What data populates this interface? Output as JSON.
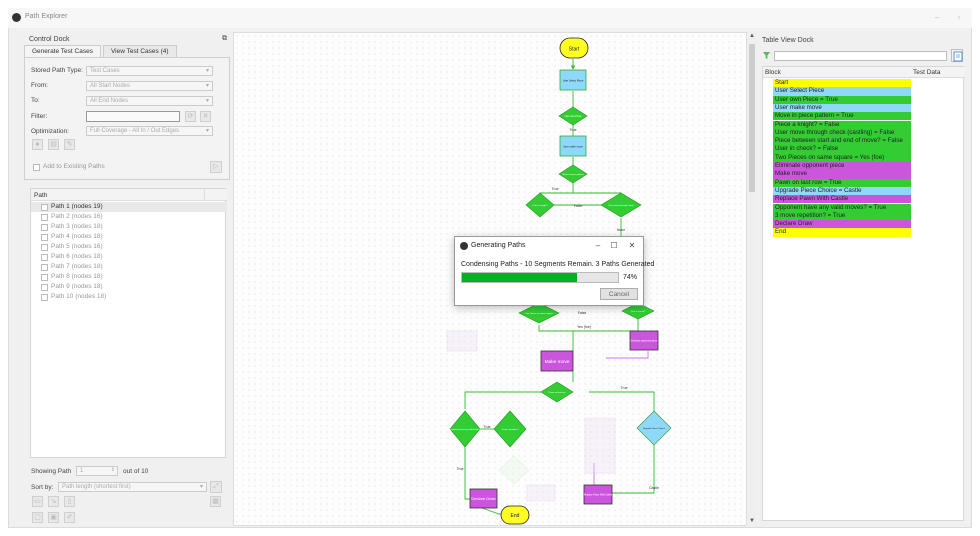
{
  "window": {
    "title": "Path Explorer"
  },
  "control_dock": {
    "title": "Control Dock",
    "tabs": [
      "Generate Test Cases",
      "View Test Cases (4)"
    ],
    "stored_path_type_label": "Stored Path Type:",
    "stored_path_type_value": "Test Cases",
    "from_label": "From:",
    "from_value": "All Start Nodes",
    "to_label": "To:",
    "to_value": "All End Nodes",
    "filter_label": "Filter:",
    "optimization_label": "Optimization:",
    "optimization_value": "Full Coverage - All In / Out Edges",
    "add_existing_label": "Add to Existing Paths",
    "path_column": "Path",
    "paths": [
      "Path 1 (nodes 19)",
      "Path 2 (nodes 16)",
      "Path 3 (nodes 18)",
      "Path 4 (nodes 18)",
      "Path 5 (nodes 16)",
      "Path 6 (nodes 18)",
      "Path 7 (nodes 18)",
      "Path 8 (nodes 18)",
      "Path 9 (nodes 18)",
      "Path 10 (nodes 18)"
    ],
    "showing_path_label": "Showing Path",
    "showing_path_value": "1",
    "out_of_label": "out of 10",
    "sort_by_label": "Sort by:",
    "sort_by_value": "Path length (shortest first)"
  },
  "canvas": {
    "nodes": {
      "start": "Start",
      "user_select": "User Select Piece",
      "own_piece": "User own Piece",
      "user_make_move": "User make move",
      "move_in_pattern": "Move in piece pattern",
      "is_knight": "Piece a knight?",
      "move_through_check": "User move through check",
      "same_square": "Two Pieces on same square",
      "user_in_check": "User in check?",
      "eliminate": "Eliminate opponent piece",
      "make_move": "Make move",
      "pawn_last_row": "Pawn on last row",
      "opponent_moves": "Opponent have any valid moves?",
      "three_move": "3 move repetition?",
      "upgrade": "Upgrade Piece Choice",
      "declare_draw": "Declare Draw",
      "replace_pawn": "Replace Pawn With Castle",
      "end": "End"
    },
    "edge_labels": {
      "true": "True",
      "false": "False",
      "yes_foe": "Yes (foe)",
      "none": "None",
      "castle": "Castle"
    }
  },
  "dialog": {
    "title": "Generating Paths",
    "message": "Condensing Paths - 10 Segments Remain. 3 Paths Generated",
    "progress": 0.74,
    "progress_label": "74%",
    "cancel_label": "Cancel"
  },
  "table_view": {
    "title": "Table View Dock",
    "col_block": "Block",
    "col_test_data": "Test Data",
    "colors": {
      "yellow": "#ffff00",
      "blue": "#8ed8f8",
      "green": "#33cc33",
      "purple": "#cc55dd"
    },
    "rows": [
      {
        "text": "Start",
        "color": "yellow"
      },
      {
        "text": "User Select Piece",
        "color": "blue"
      },
      {
        "text": "User own Piece = True",
        "color": "green"
      },
      {
        "text": "User make move",
        "color": "blue"
      },
      {
        "text": "Move in piece pattern = True",
        "color": "green"
      },
      {
        "text": "Piece a knight? = False",
        "color": "green"
      },
      {
        "text": "User move through check (castling) = False",
        "color": "green"
      },
      {
        "text": "Piece between start and end of move? = False",
        "color": "green"
      },
      {
        "text": "User in check? = False",
        "color": "green"
      },
      {
        "text": "Two Pieces on same square = Yes (foe)",
        "color": "green"
      },
      {
        "text": "Eliminate opponent piece",
        "color": "purple"
      },
      {
        "text": "Make move",
        "color": "purple"
      },
      {
        "text": "Pawn on last row = True",
        "color": "green"
      },
      {
        "text": "Upgrade Piece Choice = Castle",
        "color": "blue"
      },
      {
        "text": "Replace Pawn With Castle",
        "color": "purple"
      },
      {
        "text": "Opponent have any valid moves? = True",
        "color": "green"
      },
      {
        "text": "3 move repetition? = True",
        "color": "green"
      },
      {
        "text": "Declare Draw",
        "color": "purple"
      },
      {
        "text": "End",
        "color": "yellow"
      }
    ]
  }
}
